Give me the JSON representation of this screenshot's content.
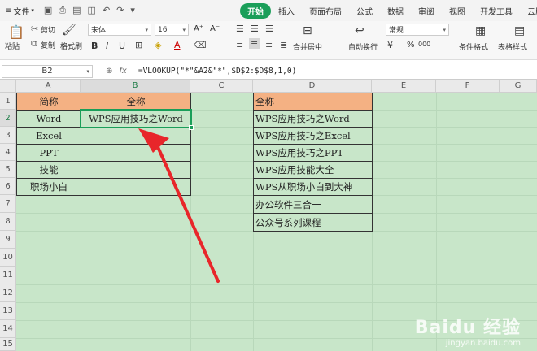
{
  "menubar": {
    "file_label": "文件",
    "tabs": [
      "开始",
      "插入",
      "页面布局",
      "公式",
      "数据",
      "审阅",
      "视图",
      "开发工具",
      "云服"
    ]
  },
  "ribbon": {
    "paste": "粘贴",
    "cut": "剪切",
    "copy": "复制",
    "format_painter": "格式刷",
    "font_name": "宋体",
    "font_size": "16",
    "merge_center": "合并居中",
    "wrap_text": "自动换行",
    "number_format": "常规",
    "conditional_format": "条件格式",
    "table_style": "表格样式",
    "bold": "B",
    "italic": "I",
    "underline": "U",
    "font_color": "A",
    "increase_font": "A⁺",
    "decrease_font": "A⁻",
    "percent": "%",
    "thousands": "000"
  },
  "formula_bar": {
    "name_box": "B2",
    "fx": "fx",
    "formula": "=VLOOKUP(\"*\"&A2&\"*\",$D$2:$D$8,1,0)"
  },
  "sheet": {
    "columns": [
      "A",
      "B",
      "C",
      "D",
      "E",
      "F",
      "G"
    ],
    "rows": [
      "1",
      "2",
      "3",
      "4",
      "5",
      "6",
      "7",
      "8",
      "9",
      "10",
      "11",
      "12",
      "13",
      "14",
      "15"
    ],
    "a_header": "简称",
    "b_header": "全称",
    "a_values": [
      "Word",
      "Excel",
      "PPT",
      "技能",
      "职场小白"
    ],
    "b_values": [
      "WPS应用技巧之Word",
      "",
      "",
      "",
      ""
    ],
    "d_header": "全称",
    "d_values": [
      "WPS应用技巧之Word",
      "WPS应用技巧之Excel",
      "WPS应用技巧之PPT",
      "WPS应用技能大全",
      "WPS从职场小白到大神",
      "办公软件三合一",
      "公众号系列课程"
    ]
  },
  "watermark": {
    "brand": "Baidu 经验",
    "url": "jingyan.baidu.com"
  },
  "colors": {
    "accent": "#1a9e59",
    "header_fill": "#f4b183",
    "sheet_bg": "#c8e6c9",
    "arrow": "#e8262a"
  }
}
